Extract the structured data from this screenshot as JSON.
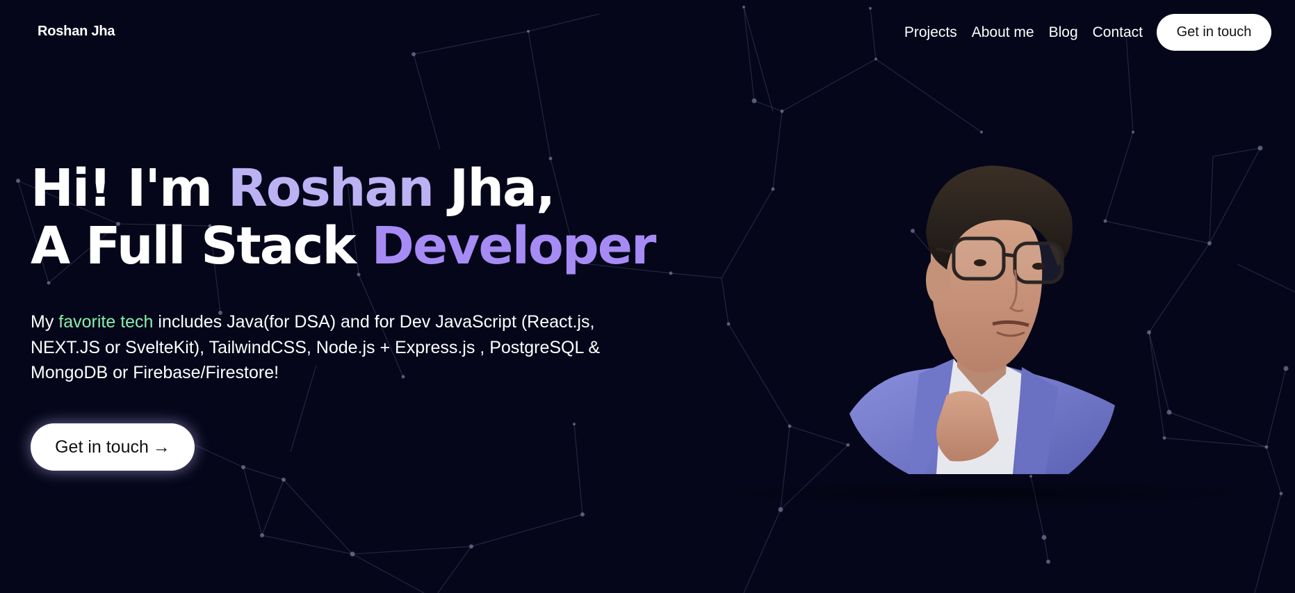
{
  "brand": {
    "name": "Roshan Jha"
  },
  "nav": {
    "links": [
      "Projects",
      "About me",
      "Blog",
      "Contact"
    ],
    "cta": "Get in touch"
  },
  "hero": {
    "title": {
      "line1_prefix": "Hi! I'm ",
      "line1_accent": "Roshan",
      "line1_suffix": " Jha,",
      "line2_prefix": "A Full Stack ",
      "line2_accent": "Developer"
    },
    "description": {
      "prefix": "My ",
      "highlight": "favorite tech",
      "rest": " includes Java(for DSA) and for Dev JavaScript (React.js, NEXT.JS or SvelteKit), TailwindCSS, Node.js + Express.js , PostgreSQL & MongoDB or Firebase/Firestore!"
    },
    "cta_label": "Get in touch",
    "cta_arrow": "→"
  },
  "colors": {
    "background": "#05061a",
    "accent_light": "#bcb2f3",
    "accent_purple": "#a78bf5",
    "highlight_green": "#86efac",
    "button_bg": "#ffffff"
  },
  "icons": {
    "background": "particle-network-icon",
    "arrow": "arrow-right-icon"
  }
}
